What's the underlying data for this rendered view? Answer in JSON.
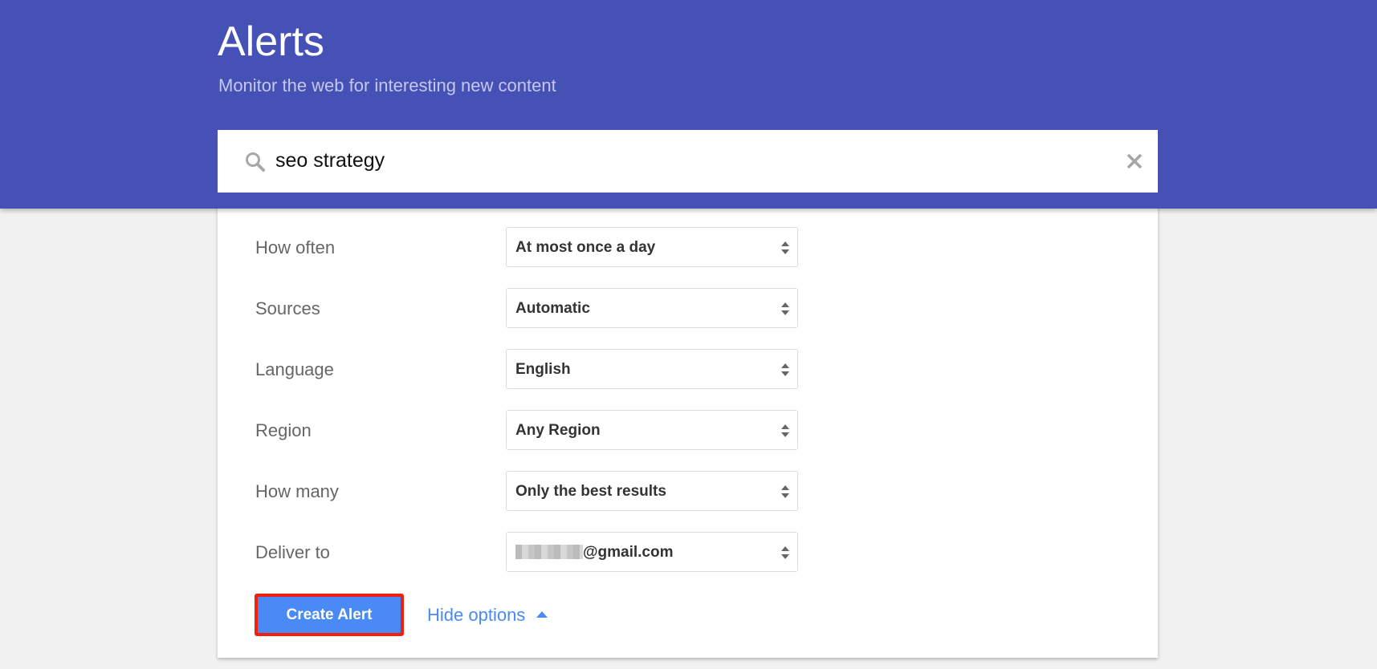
{
  "header": {
    "title": "Alerts",
    "subtitle": "Monitor the web for interesting new content",
    "background_color": "#4651b5"
  },
  "search": {
    "value": "seo strategy",
    "icon": "search-icon",
    "clear_icon": "close-icon"
  },
  "options": [
    {
      "label": "How often",
      "value": "At most once a day"
    },
    {
      "label": "Sources",
      "value": "Automatic"
    },
    {
      "label": "Language",
      "value": "English"
    },
    {
      "label": "Region",
      "value": "Any Region"
    },
    {
      "label": "How many",
      "value": "Only the best results"
    },
    {
      "label": "Deliver to",
      "value": "@gmail.com"
    }
  ],
  "actions": {
    "create_label": "Create Alert",
    "hide_options_label": "Hide options",
    "accent_color": "#4a8af4",
    "highlight_color": "#f0200e"
  }
}
